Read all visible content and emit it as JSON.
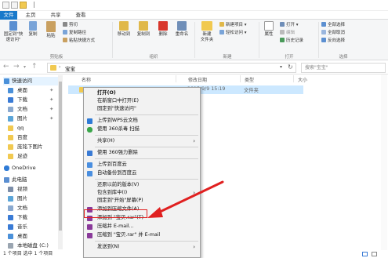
{
  "titlebar": {
    "separator": "|"
  },
  "tabs": {
    "file": "文件",
    "home": "主页",
    "share": "共享",
    "view": "查看"
  },
  "ribbon": {
    "pin_label": "固定到\"快\n速访问\"",
    "copy_label": "复制",
    "paste_label": "粘贴",
    "cut_label": "剪切",
    "copy_path_label": "复制路径",
    "paste_shortcut_label": "粘贴快捷方式",
    "move_to_label": "移动到",
    "copy_to_label": "复制到",
    "delete_label": "删除",
    "rename_label": "重命名",
    "new_folder_label": "新建\n文件夹",
    "new_item_label": "新建项目",
    "easy_access_label": "轻松访问",
    "properties_label": "属性",
    "open_label": "打开",
    "edit_label": "编辑",
    "history_label": "历史记录",
    "select_all_label": "全部选择",
    "select_none_label": "全部取消",
    "invert_label": "反向选择",
    "group_clipboard": "剪贴板",
    "group_organize": "组织",
    "group_new": "新建",
    "group_open": "打开",
    "group_select": "选择"
  },
  "address": {
    "path": "宝宝",
    "search_placeholder": "搜索\"宝宝\""
  },
  "nav": {
    "quick_access": "快速访问",
    "desktop": "桌面",
    "downloads": "下载",
    "documents": "文档",
    "pictures": "图片",
    "qq": "qq",
    "baidu": "百度",
    "baby_pictures": "庞铭下图片",
    "footprints": "足迹",
    "onedrive": "OneDrive",
    "this_pc": "此电脑",
    "videos": "视频",
    "pc_pictures": "图片",
    "pc_documents": "文档",
    "pc_downloads": "下载",
    "music": "音乐",
    "pc_desktop": "桌面",
    "local_disk": "本地磁盘 (C:)"
  },
  "columns": {
    "name": "名称",
    "date": "修改日期",
    "type": "类型",
    "size": "大小"
  },
  "file": {
    "date": "2015/9/9 15:19",
    "type": "文件夹"
  },
  "status": {
    "text": "1 个项目   选中 1 个项目"
  },
  "context_menu": {
    "open": "打开(O)",
    "open_new_window": "在新窗口中打开(E)",
    "pin_quick": "固定到\"快速访问\"",
    "wps_upload": "上传到WPS云文档",
    "scan_360": "使用 360杀毒 扫描",
    "share": "共享(H)",
    "shred_360": "使用 360强力删除",
    "baidu_upload": "上传到百度云",
    "baidu_backup": "自动备份到百度云",
    "restore": "还原以前的版本(V)",
    "include_library": "包含到库中(I)",
    "pin_start": "固定到\"开始\"屏幕(P)",
    "add_archive": "添加到压缩文件(A)...",
    "add_rar": "添加到 \"宝贝.rar\"(T)",
    "compress_email": "压缩并 E-mail...",
    "compress_rar_email": "压缩到 \"宝贝.rar\" 并 E-mail",
    "send_to": "发送到(N)"
  },
  "colors": {
    "accent": "#1979ca",
    "highlight": "#e02020",
    "selection": "#cce8ff"
  }
}
